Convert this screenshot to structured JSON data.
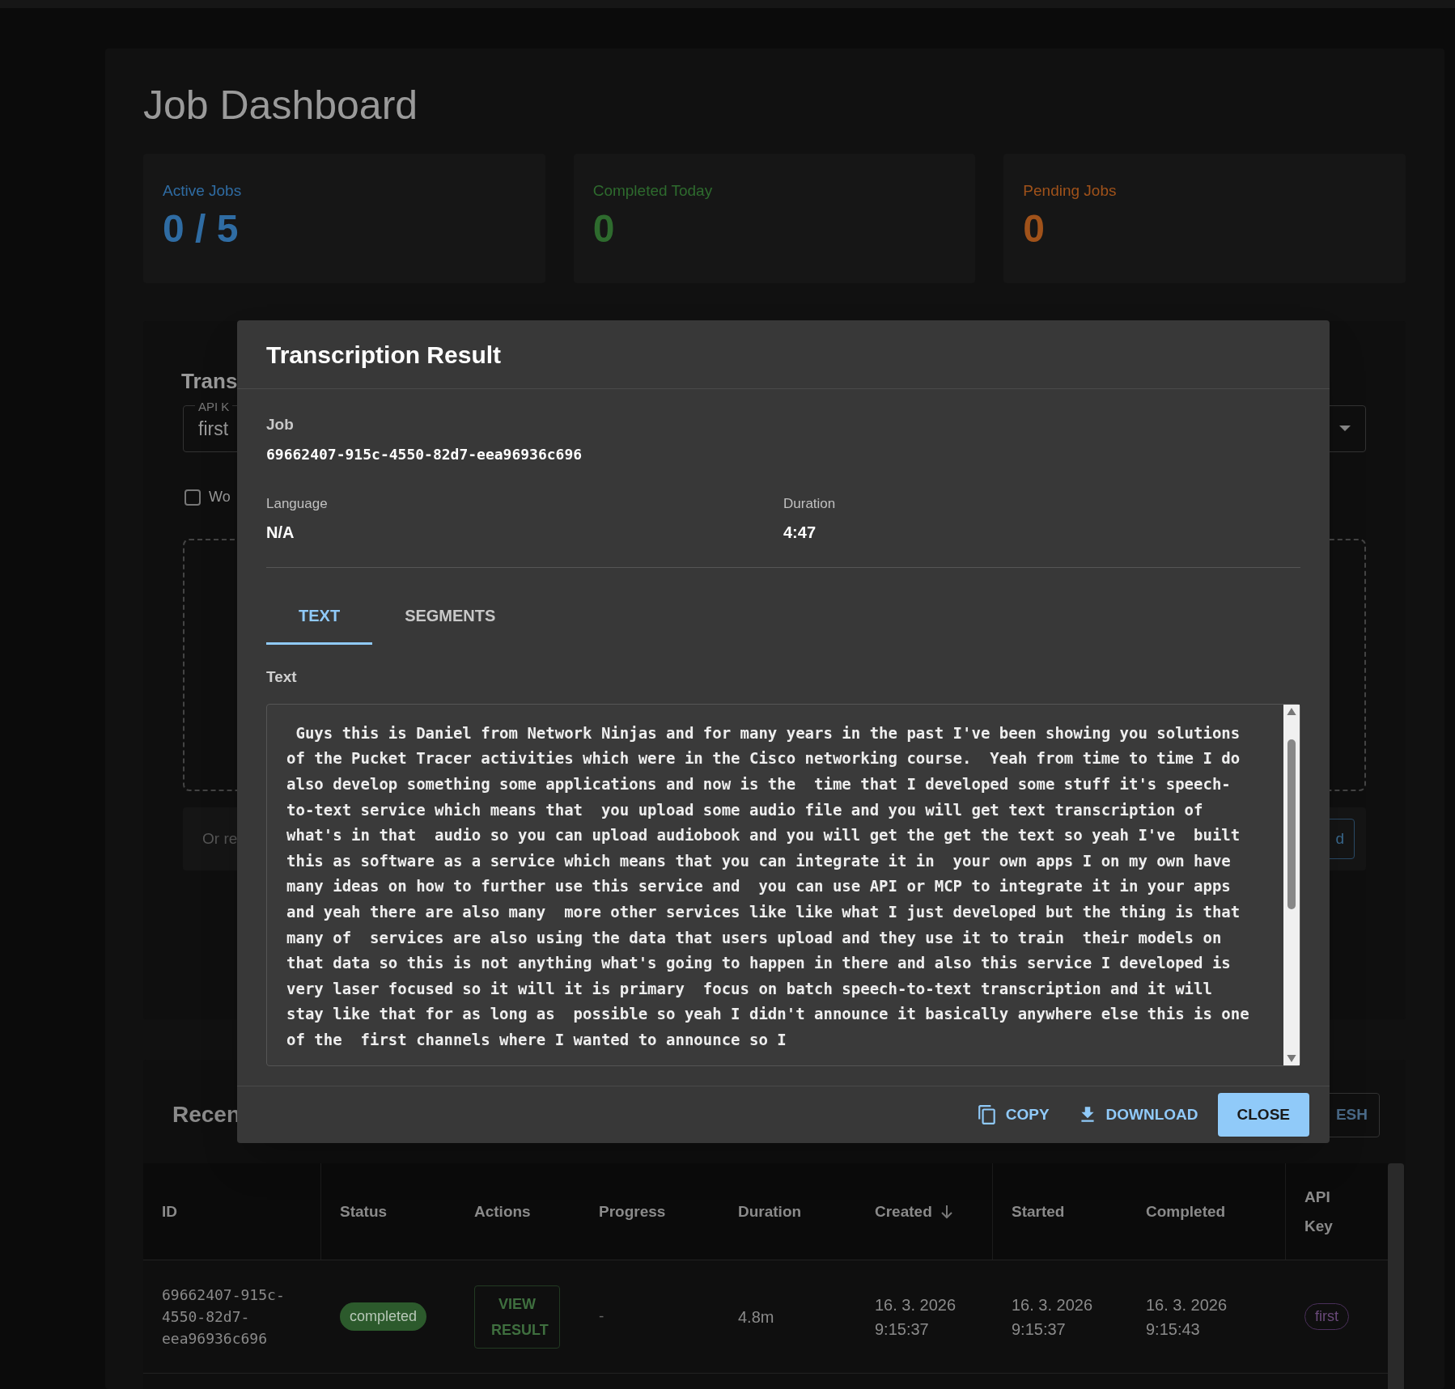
{
  "page_title": "Job Dashboard",
  "stats": [
    {
      "label": "Active Jobs",
      "value": "0 / 5",
      "color": "#2f6ca3"
    },
    {
      "label": "Completed Today",
      "value": "0",
      "color": "#2e6b2e"
    },
    {
      "label": "Pending Jobs",
      "value": "0",
      "color": "#a0521a"
    }
  ],
  "upload_panel": {
    "title": "Trans",
    "api_key_field": {
      "label": "API K",
      "value": "first"
    },
    "checkbox": {
      "label": "Wo",
      "checked": false
    },
    "url_field": {
      "placeholder": "Or re"
    },
    "url_button": "d"
  },
  "recent_jobs": {
    "title": "Recen",
    "refresh_button": "ESH",
    "columns": [
      {
        "label": "ID",
        "sorted": false
      },
      {
        "label": "Status",
        "sorted": false
      },
      {
        "label": "Actions",
        "sorted": false
      },
      {
        "label": "Progress",
        "sorted": false
      },
      {
        "label": "Duration",
        "sorted": false
      },
      {
        "label": "Created",
        "sorted": true
      },
      {
        "label": "Started",
        "sorted": false
      },
      {
        "label": "Completed",
        "sorted": false
      },
      {
        "label": "API Key",
        "sorted": false
      }
    ],
    "rows": [
      {
        "id": "69662407-915c-4550-82d7-eea96936c696",
        "status": "completed",
        "action": "VIEW RESULT",
        "progress": "-",
        "duration": "4.8m",
        "created": "16. 3. 2026 9:15:37",
        "started": "16. 3. 2026 9:15:37",
        "completed": "16. 3. 2026 9:15:43",
        "api_key": "first"
      }
    ]
  },
  "modal": {
    "title": "Transcription Result",
    "job": {
      "label": "Job",
      "value": "69662407-915c-4550-82d7-eea96936c696"
    },
    "fields": [
      {
        "label": "Language",
        "value": "N/A"
      },
      {
        "label": "Duration",
        "value": "4:47"
      }
    ],
    "tabs": [
      {
        "label": "TEXT",
        "selected": true
      },
      {
        "label": "SEGMENTS",
        "selected": false
      }
    ],
    "text_label": "Text",
    "text": " Guys this is Daniel from Network Ninjas and for many years in the past I've been showing you solutions of the Pucket Tracer activities which were in the Cisco networking course.  Yeah from time to time I do also develop something some applications and now is the  time that I developed some stuff it's speech-to-text service which means that  you upload some audio file and you will get text transcription of what's in that  audio so you can upload audiobook and you will get the get the text so yeah I've  built this as software as a service which means that you can integrate it in  your own apps I on my own have many ideas on how to further use this service and  you can use API or MCP to integrate it in your apps and yeah there are also many  more other services like like what I just developed but the thing is that many of  services are also using the data that users upload and they use it to train  their models on that data so this is not anything what's going to happen in there and also this service I developed is very laser focused so it will it is primary  focus on batch speech-to-text transcription and it will stay like that for as long as  possible so yeah I didn't announce it basically anywhere else this is one of the  first channels where I wanted to announce so I",
    "actions": [
      {
        "kind": "copy",
        "label": "COPY"
      },
      {
        "kind": "download",
        "label": "DOWNLOAD"
      },
      {
        "kind": "close",
        "label": "CLOSE"
      }
    ]
  }
}
